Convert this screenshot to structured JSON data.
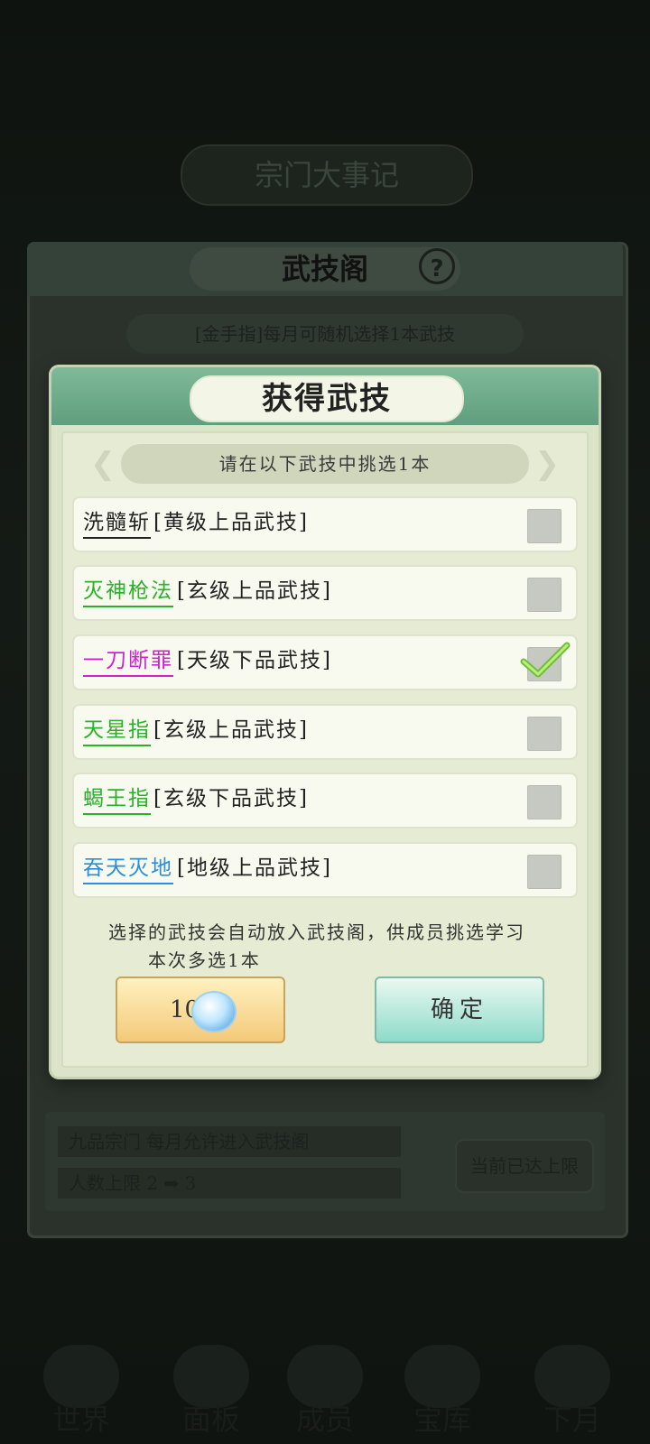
{
  "background": {
    "banner": "宗门大事记",
    "hall_title": "武技阁",
    "help_symbol": "?",
    "subtitle": "[金手指]每月可随机选择1本武技",
    "footer_row1": "九品宗门  每月允许进入武技阁",
    "footer_row2": "人数上限  2 ➡ 3",
    "limit_button": "当前已达上限",
    "nav": [
      "世界",
      "面板",
      "成员",
      "宝库",
      "下月"
    ]
  },
  "dialog": {
    "title": "获得武技",
    "instruction": "请在以下武技中挑选1本",
    "skills": [
      {
        "name": "洗髓斩",
        "grade": "[黄级上品武技]",
        "color": "#222222",
        "checked": false
      },
      {
        "name": "灭神枪法",
        "grade": "[玄级上品武技]",
        "color": "#2bb02b",
        "checked": false
      },
      {
        "name": "一刀断罪",
        "grade": "[天级下品武技]",
        "color": "#d320d3",
        "checked": true
      },
      {
        "name": "天星指",
        "grade": "[玄级上品武技]",
        "color": "#2bb02b",
        "checked": false
      },
      {
        "name": "蝎王指",
        "grade": "[玄级下品武技]",
        "color": "#2bb02b",
        "checked": false
      },
      {
        "name": "吞天灭地",
        "grade": "[地级上品武技]",
        "color": "#2a8fd8",
        "checked": false
      }
    ],
    "note_line1": "选择的武技会自动放入武技阁，供成员挑选学习",
    "note_line2": "本次多选1本",
    "cost_value": "10",
    "confirm_label": "确定"
  }
}
